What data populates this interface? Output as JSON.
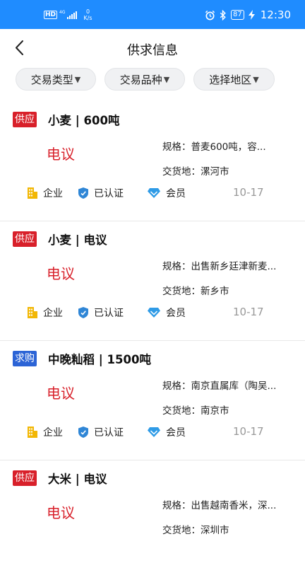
{
  "status_bar": {
    "left_badge": "HD",
    "network": "4G",
    "speed_value": "0",
    "speed_unit": "K/s",
    "battery": "87",
    "time": "12:30"
  },
  "header": {
    "title": "供求信息"
  },
  "filters": [
    {
      "label": "交易类型"
    },
    {
      "label": "交易品种"
    },
    {
      "label": "选择地区"
    }
  ],
  "filter_caret": "▼",
  "listings": [
    {
      "type": "供应",
      "type_kind": "supply",
      "title": "小麦 | 600吨",
      "price": "电议",
      "spec": "规格：普麦600吨，容...",
      "location": "交货地：漯河市",
      "tag_company": "企业",
      "tag_verified": "已认证",
      "tag_member": "会员",
      "date": "10-17"
    },
    {
      "type": "供应",
      "type_kind": "supply",
      "title": "小麦 | 电议",
      "price": "电议",
      "spec": "规格：出售新乡廷津新麦...",
      "location": "交货地：新乡市",
      "tag_company": "企业",
      "tag_verified": "已认证",
      "tag_member": "会员",
      "date": "10-17"
    },
    {
      "type": "求购",
      "type_kind": "demand",
      "title": "中晚籼稻 | 1500吨",
      "price": "电议",
      "spec": "规格：南京直属库（陶吴...",
      "location": "交货地：南京市",
      "tag_company": "企业",
      "tag_verified": "已认证",
      "tag_member": "会员",
      "date": "10-17"
    },
    {
      "type": "供应",
      "type_kind": "supply",
      "title": "大米 | 电议",
      "price": "电议",
      "spec": "规格：出售越南香米，深...",
      "location": "交货地：深圳市"
    }
  ],
  "colors": {
    "status_bar": "#1f8cff",
    "supply_badge": "#d8202a",
    "demand_badge": "#2c64d6",
    "price": "#d8202a",
    "company_icon": "#f2b705",
    "verified_icon": "#2f86d6",
    "member_icon": "#2f9be6"
  },
  "icons": {
    "back": "chevron-left-icon",
    "company": "building-icon",
    "verified": "shield-check-icon",
    "member": "diamond-icon"
  }
}
